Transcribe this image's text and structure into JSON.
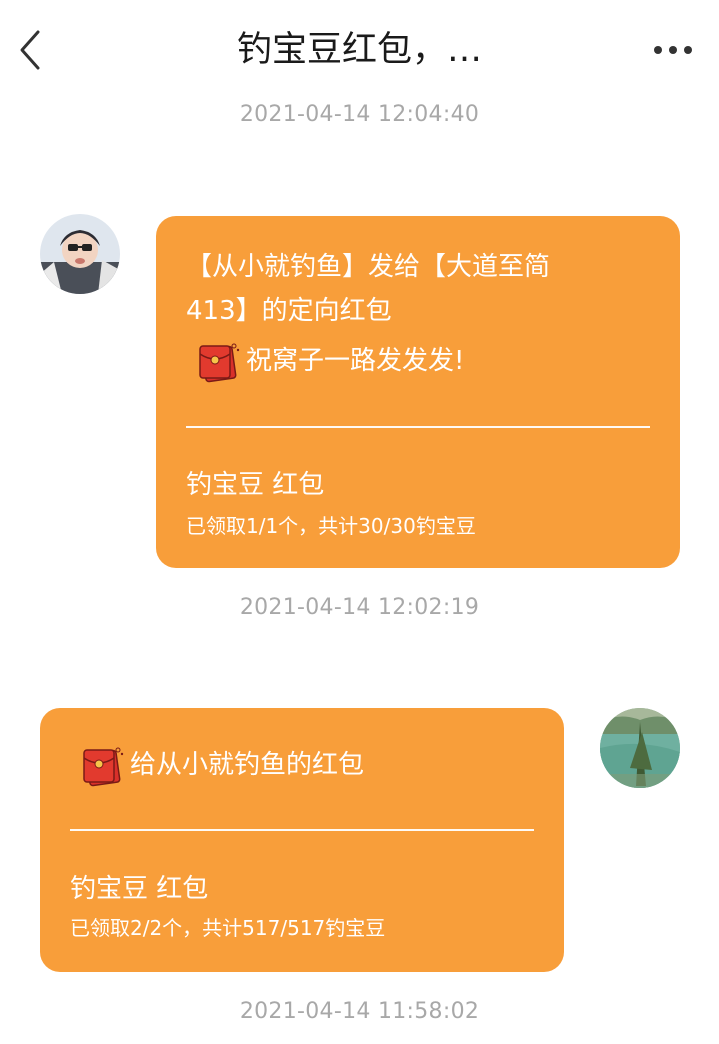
{
  "header": {
    "title": "钓宝豆红包，…"
  },
  "messages": [
    {
      "timestamp": "2021-04-14 12:04:40",
      "side": "left",
      "text_line1": "【从小就钓鱼】发给【大道至简",
      "text_line2": "413】的定向红包",
      "greeting": "祝窝子一路发发发!",
      "packet_title": "钓宝豆 红包",
      "packet_status": "已领取1/1个，共计30/30钓宝豆"
    },
    {
      "timestamp": "2021-04-14 12:02:19",
      "side": "right",
      "greeting": "给从小就钓鱼的红包",
      "packet_title": "钓宝豆 红包",
      "packet_status": "已领取2/2个，共计517/517钓宝豆"
    }
  ],
  "footer_timestamp": "2021-04-14 11:58:02",
  "colors": {
    "bubble": "#f89e3a",
    "timestamp": "#a8a8a8",
    "red_packet": "#e23a2e"
  },
  "icons": {
    "back": "chevron-left-icon",
    "more": "more-dots-icon",
    "red_packet": "red-packet-icon"
  }
}
